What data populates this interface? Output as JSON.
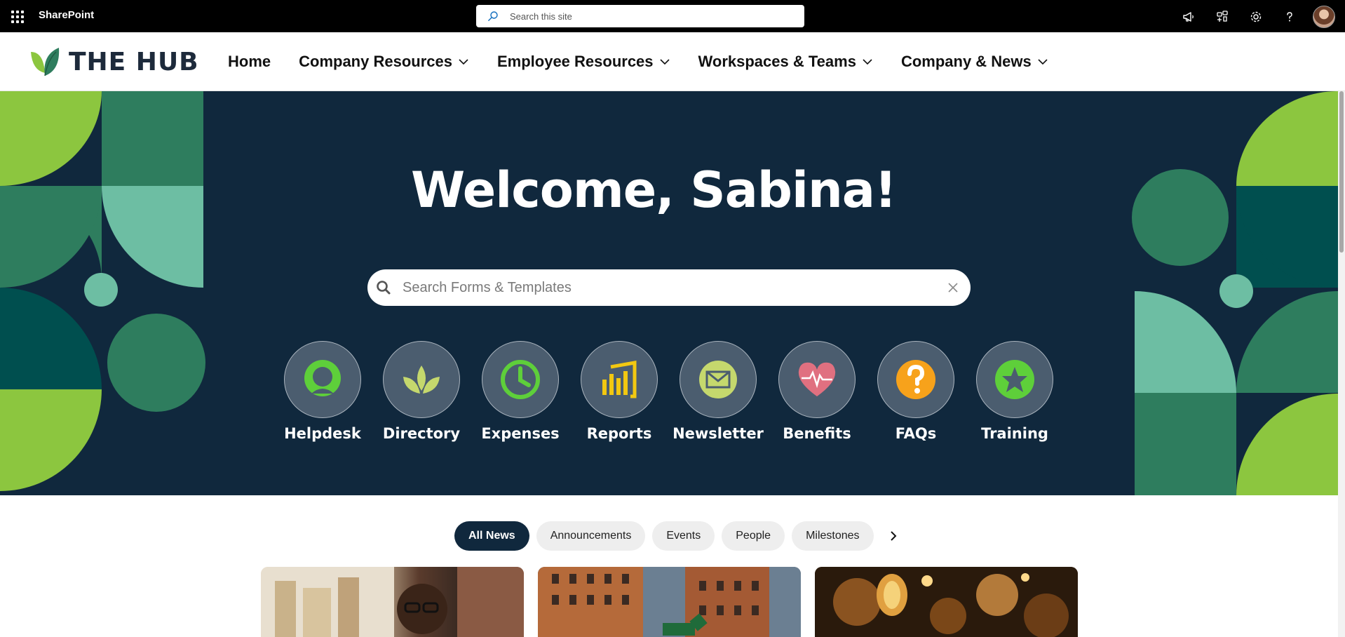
{
  "suite": {
    "brand": "SharePoint",
    "search_placeholder": "Search this site",
    "icons": [
      "megaphone-icon",
      "shield-app-icon",
      "gear-icon",
      "help-icon"
    ]
  },
  "site": {
    "logo_text": "THE HUB",
    "nav": [
      {
        "label": "Home",
        "has_dropdown": false
      },
      {
        "label": "Company Resources",
        "has_dropdown": true
      },
      {
        "label": "Employee Resources",
        "has_dropdown": true
      },
      {
        "label": "Workspaces & Teams",
        "has_dropdown": true
      },
      {
        "label": "Company & News",
        "has_dropdown": true
      }
    ]
  },
  "hero": {
    "title": "Welcome, Sabina!",
    "search_placeholder": "Search Forms & Templates",
    "quicklinks": [
      {
        "label": "Helpdesk",
        "icon": "helpdesk-icon"
      },
      {
        "label": "Directory",
        "icon": "leaf-icon"
      },
      {
        "label": "Expenses",
        "icon": "clock-icon"
      },
      {
        "label": "Reports",
        "icon": "bar-chart-icon"
      },
      {
        "label": "Newsletter",
        "icon": "envelope-icon"
      },
      {
        "label": "Benefits",
        "icon": "heart-icon"
      },
      {
        "label": "FAQs",
        "icon": "question-icon"
      },
      {
        "label": "Training",
        "icon": "star-icon"
      }
    ]
  },
  "news": {
    "filters": [
      {
        "label": "All News",
        "active": true
      },
      {
        "label": "Announcements",
        "active": false
      },
      {
        "label": "Events",
        "active": false
      },
      {
        "label": "People",
        "active": false
      },
      {
        "label": "Milestones",
        "active": false
      }
    ]
  },
  "colors": {
    "hero_bg": "#10283d",
    "lime": "#8cc63f",
    "forest": "#2e7d5e",
    "mint": "#6dbea3",
    "teal_dark": "#004f4f"
  }
}
